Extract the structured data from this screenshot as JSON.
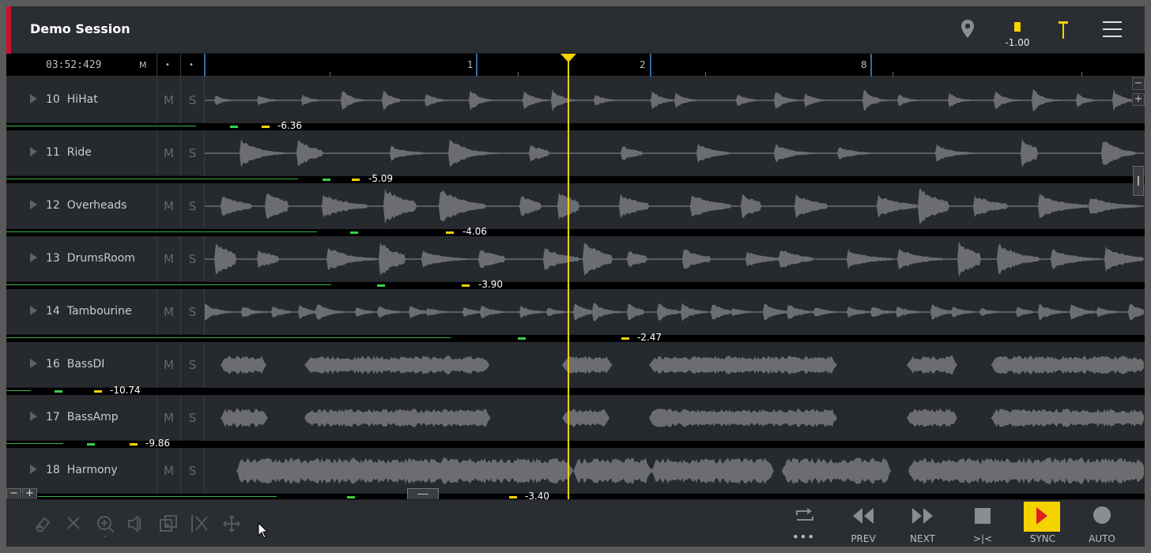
{
  "header": {
    "title": "Demo Session",
    "level_value": "-1.00",
    "accent_color": "#c8102e",
    "meter_color": "#f5d300",
    "icons": [
      "location-pin-icon",
      "marker-icon",
      "hamburger-menu-icon"
    ]
  },
  "ruler": {
    "clock": "03:52:429",
    "mute_label": "M",
    "dot1": "•",
    "dot2": "•",
    "bar_labels": [
      "1",
      "2",
      "8"
    ]
  },
  "tracks": [
    {
      "number": "10",
      "name": "HiHat",
      "mute": "M",
      "solo": "S",
      "peak": "-6.36"
    },
    {
      "number": "11",
      "name": "Ride",
      "mute": "M",
      "solo": "S",
      "peak": "-5.09"
    },
    {
      "number": "12",
      "name": "Overheads",
      "mute": "M",
      "solo": "S",
      "peak": "-4.06"
    },
    {
      "number": "13",
      "name": "DrumsRoom",
      "mute": "M",
      "solo": "S",
      "peak": "-3.90"
    },
    {
      "number": "14",
      "name": "Tambourine",
      "mute": "M",
      "solo": "S",
      "peak": "-2.47"
    },
    {
      "number": "16",
      "name": "BassDI",
      "mute": "M",
      "solo": "S",
      "peak": "-10.74"
    },
    {
      "number": "17",
      "name": "BassAmp",
      "mute": "M",
      "solo": "S",
      "peak": "-9.86"
    },
    {
      "number": "18",
      "name": "Harmony",
      "mute": "M",
      "solo": "S",
      "peak": "-3.40"
    }
  ],
  "side_controls": {
    "zoom_out": "−",
    "zoom_in": "+"
  },
  "track_zoom": {
    "minus": "−",
    "plus": "+"
  },
  "toolbar": {
    "more_label": "•••",
    "prev_label": "PREV",
    "next_label": "NEXT",
    "stop_label": ">|<",
    "sync_label": "SYNC",
    "auto_label": "AUTO"
  }
}
